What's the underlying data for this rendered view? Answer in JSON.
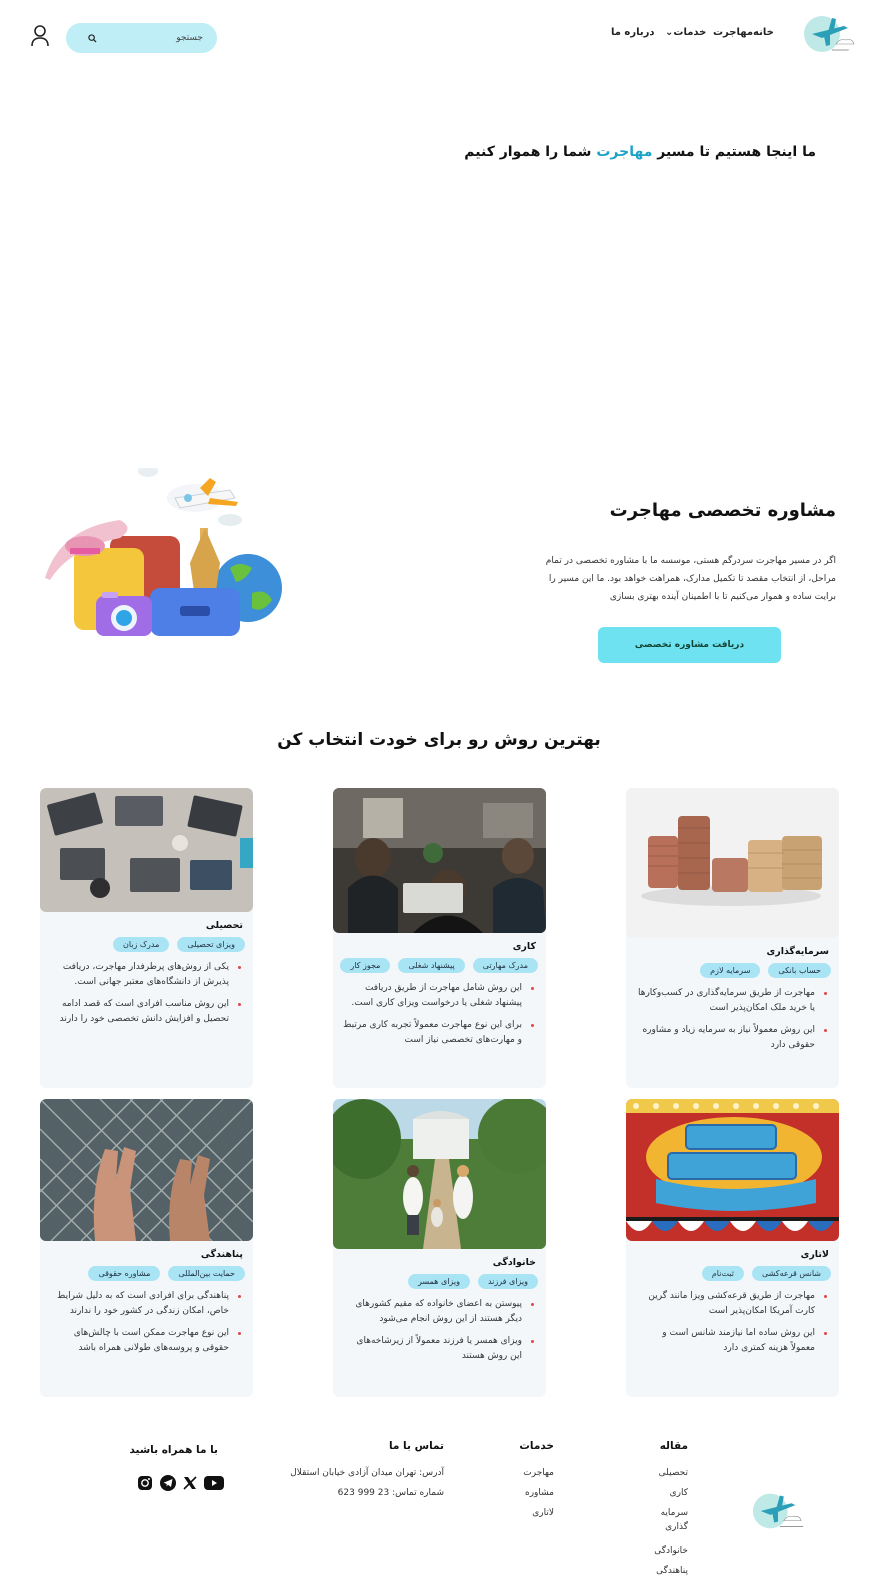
{
  "nav": {
    "home": "خانه",
    "immigration": "مهاجرت",
    "services": "خدمات",
    "about": "درباره ما"
  },
  "search": {
    "placeholder": "جستجو"
  },
  "hero": {
    "title_prefix": "ما اینجا هستیم تا مسیر ",
    "title_highlight": "مهاجرت",
    "title_suffix": " شما را هموار کنیم"
  },
  "consult": {
    "title": "مشاوره تخصصی مهاجرت",
    "text": "اگر در مسیر مهاجرت سردرگم هستی، موسسه ما با مشاوره تخصصی در تمام مراحل، از انتخاب مقصد تا تکمیل مدارک، همراهت خواهد بود. ما این مسیر را برایت ساده و هموار می‌کنیم تا با اطمینان آینده بهتری بسازی",
    "button": "دریافت مشاوره تخصصی"
  },
  "methods": {
    "title": "بهترین روش رو برای خودت انتخاب کن",
    "cards": [
      {
        "title": "سرمایه‌گذاری",
        "tags": [
          "حساب بانکی",
          "سرمایه لازم"
        ],
        "bullets": [
          "مهاجرت از طریق سرمایه‌گذاری در کسب‌وکارها یا خرید ملک امکان‌پذیر است",
          "این روش معمولاً نیاز به سرمایه زیاد و مشاوره حقوقی دارد"
        ]
      },
      {
        "title": "کاری",
        "tags": [
          "مدرک مهارتی",
          "پیشنهاد شغلی",
          "مجوز کار"
        ],
        "bullets": [
          "این روش شامل مهاجرت از طریق دریافت پیشنهاد شغلی یا درخواست ویزای کاری است.",
          "برای این نوع مهاجرت معمولاً تجربه کاری مرتبط و مهارت‌های تخصصی نیاز است"
        ]
      },
      {
        "title": "تحصیلی",
        "tags": [
          "ویزای تحصیلی",
          "مدرک زبان"
        ],
        "bullets": [
          "یکی از روش‌های پرطرفدار مهاجرت، دریافت پذیرش از دانشگاه‌های معتبر جهانی است.",
          "این روش مناسب افرادی است که قصد ادامه تحصیل و افزایش دانش تخصصی خود را دارند"
        ]
      },
      {
        "title": "لاتاری",
        "tags": [
          "شانس قرعه‌کشی",
          "ثبت‌نام"
        ],
        "bullets": [
          "مهاجرت از طریق قرعه‌کشی ویزا مانند گرین کارت آمریکا امکان‌پذیر است",
          "این روش ساده اما نیازمند شانس است و معمولاً هزینه کمتری دارد"
        ]
      },
      {
        "title": "خانوادگی",
        "tags": [
          "ویزای فرزند",
          "ویزای همسر"
        ],
        "bullets": [
          "پیوستن به اعضای خانواده که مقیم کشورهای دیگر هستند از این روش انجام می‌شود",
          "ویزای همسر یا فرزند معمولاً از زیرشاخه‌های این روش هستند"
        ]
      },
      {
        "title": "پناهندگی",
        "tags": [
          "حمایت بین‌المللی",
          "مشاوره حقوقی"
        ],
        "bullets": [
          "پناهندگی برای افرادی است که به دلیل شرایط خاص، امکان زندگی در کشور خود را ندارند",
          "این نوع مهاجرت ممکن است با چالش‌های حقوقی و پروسه‌های طولانی همراه باشد"
        ]
      }
    ]
  },
  "footer": {
    "articles": {
      "title": "مقاله",
      "items": [
        "تحصیلی",
        "کاری",
        "سرمایه گذاری",
        "خانوادگی",
        "پناهندگی"
      ]
    },
    "services": {
      "title": "خدمات",
      "items": [
        "مهاجرت",
        "مشاوره",
        "لاتاری"
      ]
    },
    "contact": {
      "title": "تماس با ما",
      "address": "آدرس: تهران میدان آزادی خیابان استقلال",
      "phone": "شماره تماس: 23 999 623"
    },
    "social": {
      "title": "با ما همراه باشید",
      "icons": [
        "youtube-icon",
        "x-icon",
        "telegram-icon",
        "instagram-icon"
      ]
    }
  }
}
